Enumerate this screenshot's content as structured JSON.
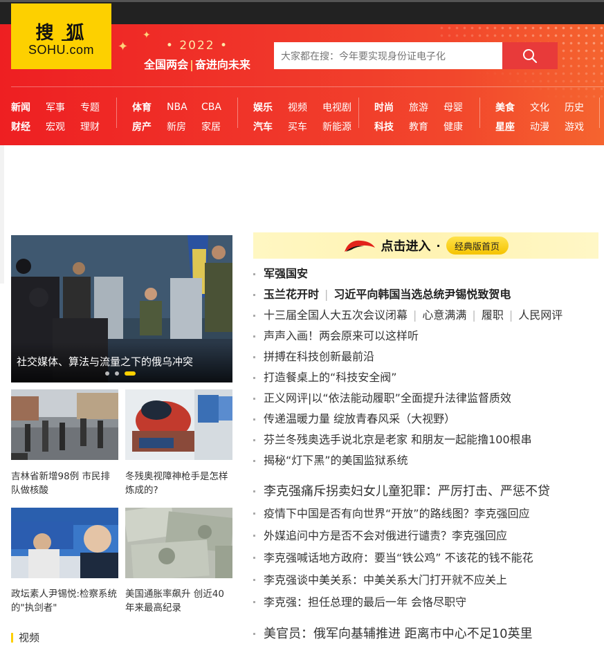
{
  "logo": {
    "cn": "搜狐",
    "en": "SOHU.com"
  },
  "slogan": {
    "year": "• 2022 •",
    "left": "全国两会",
    "right": "奋进向未来"
  },
  "search": {
    "placeholder": "大家都在搜：今年要实现身份证电子化"
  },
  "nav": {
    "groups": [
      {
        "row1": [
          "新闻",
          "军事",
          "专题"
        ],
        "row2": [
          "财经",
          "宏观",
          "理财"
        ]
      },
      {
        "row1": [
          "体育",
          "NBA",
          "CBA"
        ],
        "row2": [
          "房产",
          "新房",
          "家居"
        ]
      },
      {
        "row1": [
          "娱乐",
          "视频",
          "电视剧"
        ],
        "row2": [
          "汽车",
          "买车",
          "新能源"
        ]
      },
      {
        "row1": [
          "时尚",
          "旅游",
          "母婴"
        ],
        "row2": [
          "科技",
          "教育",
          "健康"
        ]
      },
      {
        "row1": [
          "美食",
          "文化",
          "历史"
        ],
        "row2": [
          "星座",
          "动漫",
          "游戏"
        ]
      }
    ]
  },
  "hero": {
    "caption": "社交媒体、算法与流量之下的俄乌冲突"
  },
  "thumbs": [
    {
      "caption": "吉林省新增98例 市民排队做核酸"
    },
    {
      "caption": "冬残奥视障神枪手是怎样炼成的?"
    },
    {
      "caption": "政坛素人尹锡悦:检察系统的\"执剑者\""
    },
    {
      "caption": "美国通胀率飙升 创近40年来最高纪录"
    }
  ],
  "video_section": {
    "title": "视频"
  },
  "banner": {
    "click_text": "点击进入",
    "dot": "·",
    "button": "经典版首页"
  },
  "news": {
    "top": [
      {
        "parts": [
          "军强国安"
        ]
      },
      {
        "parts": [
          "玉兰花开时",
          "习近平向韩国当选总统尹锡悦致贺电"
        ]
      },
      {
        "parts": [
          "十三届全国人大五次会议闭幕",
          "心意满满",
          "履职",
          "人民网评"
        ]
      },
      {
        "parts": [
          "声声入画！两会原来可以这样听"
        ]
      },
      {
        "parts": [
          "拼搏在科技创新最前沿"
        ]
      },
      {
        "parts": [
          "打造餐桌上的“科技安全阀”"
        ]
      },
      {
        "parts": [
          "正义网评|以“依法能动履职”全面提升法律监督质效"
        ]
      },
      {
        "parts": [
          "传递温暖力量 绽放青春风采（大视野）"
        ]
      },
      {
        "parts": [
          "芬兰冬残奥选手说北京是老家 和朋友一起能撸100根串"
        ]
      },
      {
        "parts": [
          "揭秘“灯下黑”的美国监狱系统"
        ]
      }
    ],
    "middle": [
      "李克强痛斥拐卖妇女儿童犯罪：严厉打击、严惩不贷",
      "疫情下中国是否有向世界“开放”的路线图？李克强回应",
      "外媒追问中方是否不会对俄进行谴责？李克强回应",
      "李克强喊话地方政府：要当“铁公鸡” 不该花的钱不能花",
      "李克强谈中美关系：中美关系大门打开就不应关上",
      "李克强：担任总理的最后一年 会恪尽职守"
    ],
    "bottom": [
      "美官员：俄军向基辅推进 距离市中心不足10英里"
    ]
  }
}
